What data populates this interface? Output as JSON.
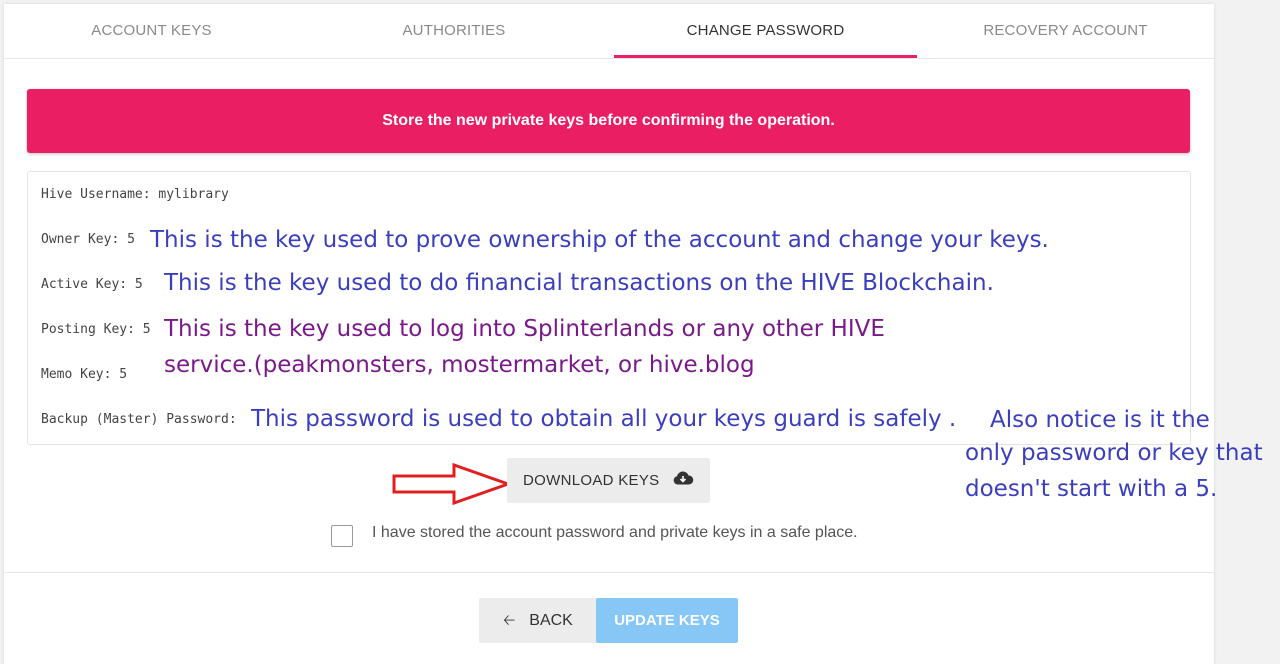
{
  "tabs": [
    {
      "label": "ACCOUNT KEYS"
    },
    {
      "label": "AUTHORITIES"
    },
    {
      "label": "CHANGE PASSWORD"
    },
    {
      "label": "RECOVERY ACCOUNT"
    }
  ],
  "active_tab": "CHANGE PASSWORD",
  "alert": {
    "text": "Store the new private keys before confirming the operation."
  },
  "keys": {
    "username_line": "Hive Username: mylibrary",
    "owner_label": "Owner Key: 5",
    "active_label": "Active Key: 5",
    "posting_label": "Posting Key: 5",
    "memo_label": "Memo Key: 5",
    "backup_label": "Backup (Master) Password:"
  },
  "annotations": {
    "owner": "This is the key used to prove ownership of the account and change your keys.",
    "active": "This is the key used to do financial transactions on the HIVE Blockchain.",
    "posting_line1": "This is the key used to log into Splinterlands or any other HIVE",
    "posting_line2": "service.(peakmonsters, mostermarket, or hive.blog",
    "backup": "This password is used to obtain all your keys guard is safely .",
    "note_line1": "Also notice is it the",
    "note_line2": "only password or key that",
    "note_line3": "doesn't start with a 5."
  },
  "download_button": {
    "label": "DOWNLOAD KEYS",
    "icon": "cloud-download-icon"
  },
  "confirm_checkbox": {
    "label": "I have stored the account password and private keys in a safe place.",
    "checked": false
  },
  "footer": {
    "back_label": "BACK",
    "update_label": "UPDATE KEYS"
  },
  "colors": {
    "accent": "#e91e63",
    "update_button": "#86c7f6",
    "annotation_blue": "#3b3fbe",
    "annotation_purple": "#7a1a8a",
    "arrow_red": "#e02020"
  }
}
